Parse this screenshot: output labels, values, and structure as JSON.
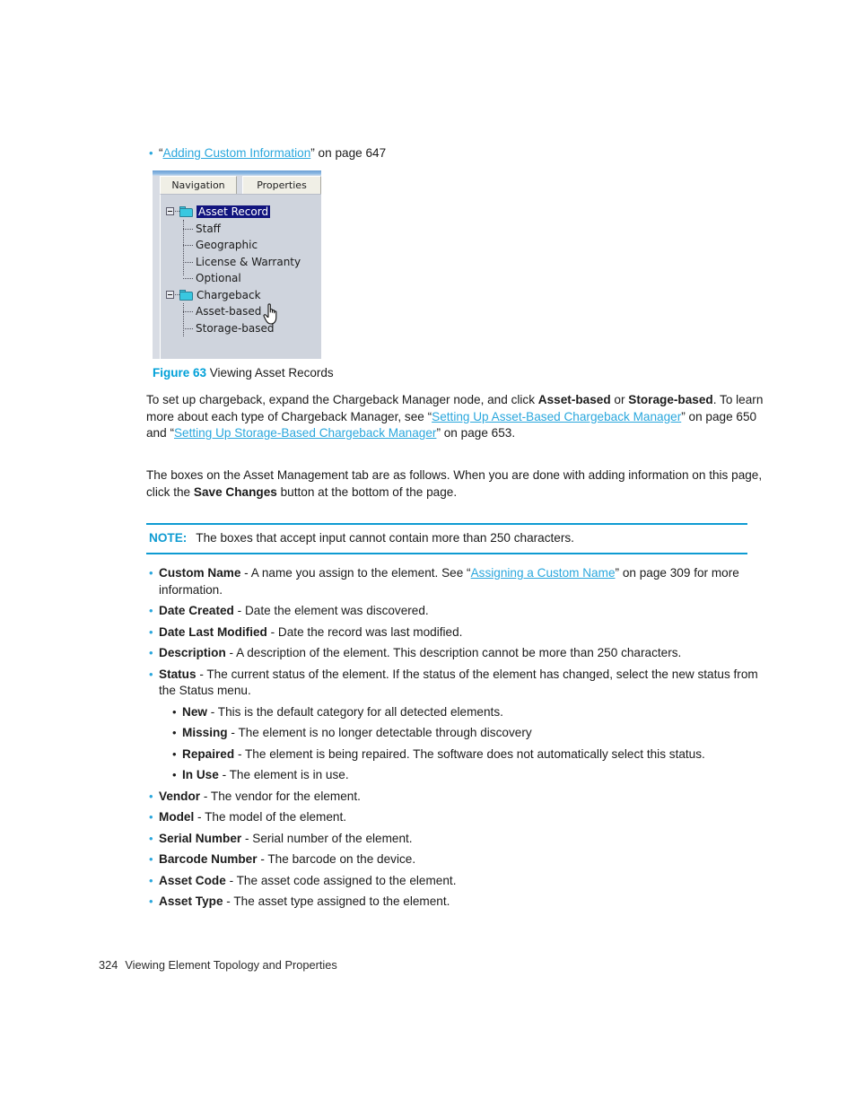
{
  "intro_bullet": {
    "quote_open": "“",
    "link_text": "Adding Custom Information",
    "quote_close": "”",
    "tail": " on page 647"
  },
  "figure": {
    "tabs": [
      {
        "label": "Navigation",
        "selected": true
      },
      {
        "label": "Properties",
        "selected": false
      }
    ],
    "tree": [
      {
        "label": "Asset Record",
        "level": 0,
        "type": "folder",
        "expanded": true,
        "selected": true
      },
      {
        "label": "Staff",
        "level": 1,
        "type": "leaf",
        "selected": false
      },
      {
        "label": "Geographic",
        "level": 1,
        "type": "leaf",
        "selected": false
      },
      {
        "label": "License & Warranty",
        "level": 1,
        "type": "leaf",
        "selected": false
      },
      {
        "label": "Optional",
        "level": 1,
        "type": "leaf",
        "selected": false
      },
      {
        "label": "Chargeback",
        "level": 0,
        "type": "folder",
        "expanded": true,
        "selected": false
      },
      {
        "label": "Asset-based",
        "level": 1,
        "type": "leaf",
        "selected": false
      },
      {
        "label": "Storage-based",
        "level": 1,
        "type": "leaf",
        "selected": false
      }
    ],
    "cursor": "pointing-hand",
    "colors": {
      "selection": "#11147e",
      "folder": "#39c8e0",
      "pane_background": "#cfd4dd",
      "tab_background": "#f0efe6"
    }
  },
  "figure_caption": {
    "number": "Figure 63",
    "title": "Viewing Asset Records"
  },
  "paragraphs": {
    "p1": {
      "s1": "To set up chargeback, expand the Chargeback Manager node, and click ",
      "b1": "Asset-based",
      "s2": " or ",
      "b2": "Storage-based",
      "s3": ". To learn more about each type of Chargeback Manager, see “",
      "link1": "Setting Up Asset-Based Chargeback Manager",
      "s4": "” on page 650 and “",
      "link2": "Setting Up Storage-Based Chargeback Manager",
      "s5": "” on page 653."
    },
    "p2": {
      "s1": "The boxes on the Asset Management tab are as follows. When you are done with adding information on this page, click the ",
      "b1": "Save Changes",
      "s2": " button at the bottom of the page."
    }
  },
  "note": {
    "label": "NOTE:",
    "text": "The boxes that accept input cannot contain more than 250 characters."
  },
  "definitions": [
    {
      "term": "Custom Name",
      "pre": " - A name you assign to the element. See “",
      "link": "Assigning a Custom Name",
      "post": "” on page 309 for more information."
    },
    {
      "term": "Date Created",
      "pre": " - Date the element was discovered.",
      "link": "",
      "post": ""
    },
    {
      "term": "Date Last Modified",
      "pre": " - Date the record was last modified.",
      "link": "",
      "post": ""
    },
    {
      "term": "Description",
      "pre": " - A description of the element. This description cannot be more than 250 characters.",
      "link": "",
      "post": ""
    },
    {
      "term": "Status",
      "pre": " - The current status of the element. If the status of the element has changed, select the new status from the Status menu.",
      "link": "",
      "post": "",
      "sub": [
        {
          "term": "New",
          "pre": " - This is the default category for all detected elements."
        },
        {
          "term": "Missing",
          "pre": " - The element is no longer detectable through discovery"
        },
        {
          "term": "Repaired",
          "pre": " - The element is being repaired. The software does not automatically select this status."
        },
        {
          "term": "In Use",
          "pre": " - The element is in use."
        }
      ]
    },
    {
      "term": "Vendor",
      "pre": " - The vendor for the element.",
      "link": "",
      "post": ""
    },
    {
      "term": "Model",
      "pre": " - The model of the element.",
      "link": "",
      "post": ""
    },
    {
      "term": "Serial Number",
      "pre": " - Serial number of the element.",
      "link": "",
      "post": ""
    },
    {
      "term": "Barcode Number",
      "pre": " - The barcode on the device.",
      "link": "",
      "post": ""
    },
    {
      "term": "Asset Code",
      "pre": " - The asset code assigned to the element.",
      "link": "",
      "post": ""
    },
    {
      "term": "Asset Type",
      "pre": " - The asset type assigned to the element.",
      "link": "",
      "post": ""
    }
  ],
  "footer": {
    "page_number": "324",
    "chapter_title": "Viewing Element Topology and Properties"
  },
  "colors": {
    "link": "#2aa7dd",
    "accent": "#00a0d8",
    "rule": "#0e9bd2",
    "text": "#1b1b1b"
  }
}
